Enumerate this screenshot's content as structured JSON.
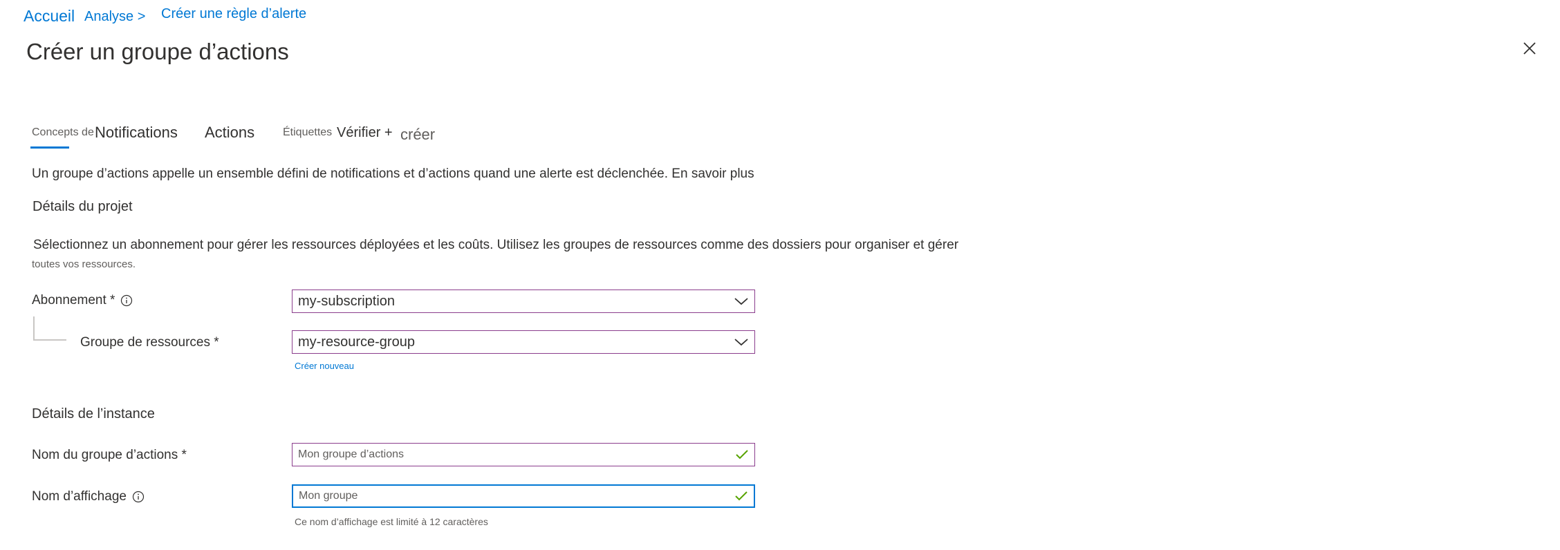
{
  "breadcrumb": {
    "home": "Accueil",
    "analysis": "Analyse >",
    "current": "Créer une règle d’alerte"
  },
  "page": {
    "title": "Créer un groupe d’actions"
  },
  "tabs": [
    {
      "label": "Concepts de",
      "selected": true
    },
    {
      "label": "Notifications"
    },
    {
      "label": "Actions"
    },
    {
      "label": "Étiquettes"
    },
    {
      "label": "Vérifier +"
    },
    {
      "label": "créer"
    }
  ],
  "intro": "Un groupe d’actions appelle un ensemble défini de notifications et d’actions quand une alerte est déclenchée. En savoir plus",
  "project": {
    "heading": "Détails du projet",
    "description_line1": "Sélectionnez un abonnement pour gérer les ressources déployées et les coûts. Utilisez les groupes de ressources comme des dossiers pour organiser et gérer",
    "description_line2": "toutes vos ressources.",
    "subscription_label": "Abonnement *",
    "subscription_value": "my-subscription",
    "resource_group_label": "Groupe de ressources *",
    "resource_group_value": "my-resource-group",
    "create_new_link": "Créer nouveau"
  },
  "instance": {
    "heading": "Détails de l’instance",
    "action_group_name_label": "Nom du groupe d’actions *",
    "action_group_name_value": "Mon groupe d’actions",
    "display_name_label": "Nom d’affichage",
    "display_name_value": "Mon groupe",
    "display_name_hint": "Ce nom d’affichage est limité à 12 caractères"
  },
  "colors": {
    "accent": "#0078d4",
    "field_border": "#8a3c8c",
    "valid_check": "#57a300",
    "text": "#323130",
    "muted": "#605e5c"
  },
  "icons": {
    "close": "close-icon",
    "info": "info-icon",
    "dropdown": "chevron-down-icon",
    "valid": "checkmark-icon"
  }
}
